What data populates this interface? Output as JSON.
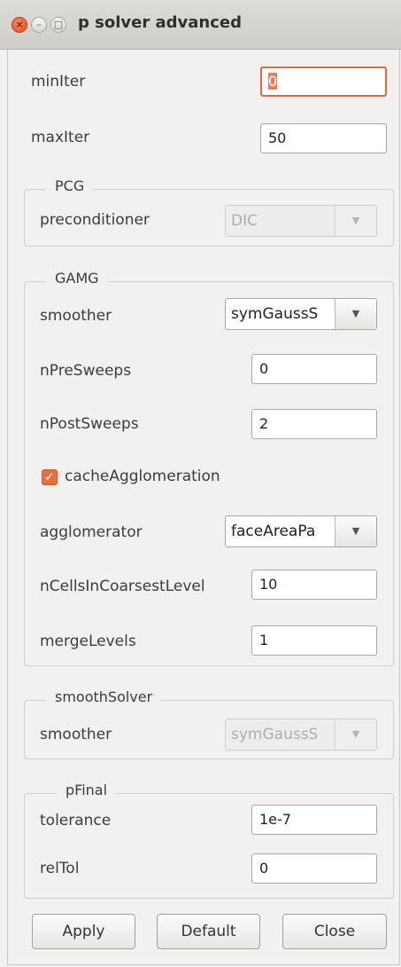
{
  "window": {
    "title": "p solver advanced",
    "controls": {
      "close": "×",
      "minimize": "–",
      "maximize": "□"
    }
  },
  "fields": {
    "minIter": {
      "label": "minIter",
      "value": "0"
    },
    "maxIter": {
      "label": "maxIter",
      "value": "50"
    }
  },
  "pcg": {
    "title": "PCG",
    "preconditioner": {
      "label": "preconditioner",
      "value": "DIC"
    }
  },
  "gamg": {
    "title": "GAMG",
    "smoother": {
      "label": "smoother",
      "value": "symGaussS"
    },
    "nPreSweeps": {
      "label": "nPreSweeps",
      "value": "0"
    },
    "nPostSweeps": {
      "label": "nPostSweeps",
      "value": "2"
    },
    "cacheAgglomeration": {
      "label": "cacheAgglomeration",
      "checked": true,
      "mark": "✓"
    },
    "agglomerator": {
      "label": "agglomerator",
      "value": "faceAreaPa"
    },
    "nCellsInCoarsestLevel": {
      "label": "nCellsInCoarsestLevel",
      "value": "10"
    },
    "mergeLevels": {
      "label": "mergeLevels",
      "value": "1"
    }
  },
  "smoothSolver": {
    "title": "smoothSolver",
    "smoother": {
      "label": "smoother",
      "value": "symGaussS"
    }
  },
  "pFinal": {
    "title": "pFinal",
    "tolerance": {
      "label": "tolerance",
      "value": "1e-7"
    },
    "relTol": {
      "label": "relTol",
      "value": "0"
    }
  },
  "buttons": {
    "apply": "Apply",
    "default": "Default",
    "close": "Close"
  },
  "icons": {
    "dropdown": "▼"
  },
  "colors": {
    "accent": "#e4713f",
    "window_bg": "#f2f1f0"
  }
}
